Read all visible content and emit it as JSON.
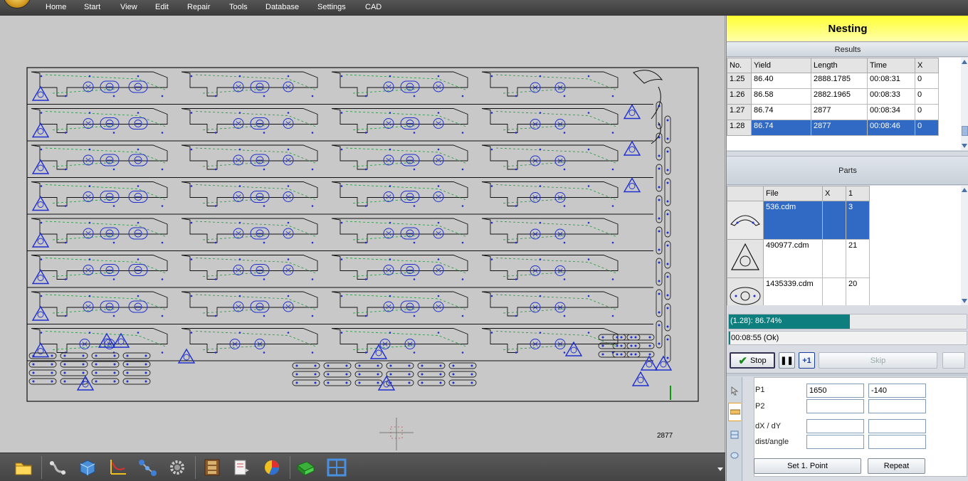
{
  "menu": {
    "items": [
      "Home",
      "Start",
      "View",
      "Edit",
      "Repair",
      "Tools",
      "Database",
      "Settings",
      "CAD"
    ]
  },
  "canvas": {
    "length_label": "2877"
  },
  "toolbar": {
    "icons": [
      "folder-icon",
      "link-chain-icon",
      "cube-icon",
      "axes-icon",
      "nodes-icon",
      "gear-icon",
      "film-strip-icon",
      "document-arrow-icon",
      "pie-chart-icon",
      "green-arrow-icon",
      "nest-layout-icon"
    ]
  },
  "panel": {
    "title": "Nesting",
    "results_title": "Results",
    "results": {
      "headers": [
        "No.",
        "Yield",
        "Length",
        "Time",
        "X"
      ],
      "rows": [
        [
          "1.25",
          "86.40",
          "2888.1785",
          "00:08:31",
          "0"
        ],
        [
          "1.26",
          "86.58",
          "2882.1965",
          "00:08:33",
          "0"
        ],
        [
          "1.27",
          "86.74",
          "2877",
          "00:08:34",
          "0"
        ],
        [
          "1.28",
          "86.74",
          "2877",
          "00:08:46",
          "0"
        ]
      ],
      "selected_row": 3
    },
    "parts_title": "Parts",
    "parts": {
      "headers": [
        "",
        "File",
        "X",
        "1"
      ],
      "rows": [
        {
          "file": "536.cdm",
          "x": "",
          "count": "3",
          "thumb": "arc-part-icon"
        },
        {
          "file": "490977.cdm",
          "x": "",
          "count": "21",
          "thumb": "triangle-part-icon"
        },
        {
          "file": "1435339.cdm",
          "x": "",
          "count": "20",
          "thumb": "oval-part-icon"
        }
      ],
      "selected_row": 0
    },
    "progress": {
      "label": "(1.28): 86.74%",
      "fraction": 0.51
    },
    "time_status": "00:08:55 (Ok)",
    "buttons": {
      "stop": "Stop",
      "pause": "❚❚",
      "plus_one": "+1",
      "skip": "Skip",
      "set_point": "Set 1. Point",
      "repeat": "Repeat"
    },
    "measure": {
      "p1_label": "P1",
      "p1_x": "1650",
      "p1_y": "-140",
      "p2_label": "P2",
      "p2_x": "",
      "p2_y": "",
      "dxdy_label": "dX / dY",
      "dx": "",
      "dy": "",
      "dist_label": "dist/angle",
      "dist": "",
      "angle": ""
    }
  }
}
